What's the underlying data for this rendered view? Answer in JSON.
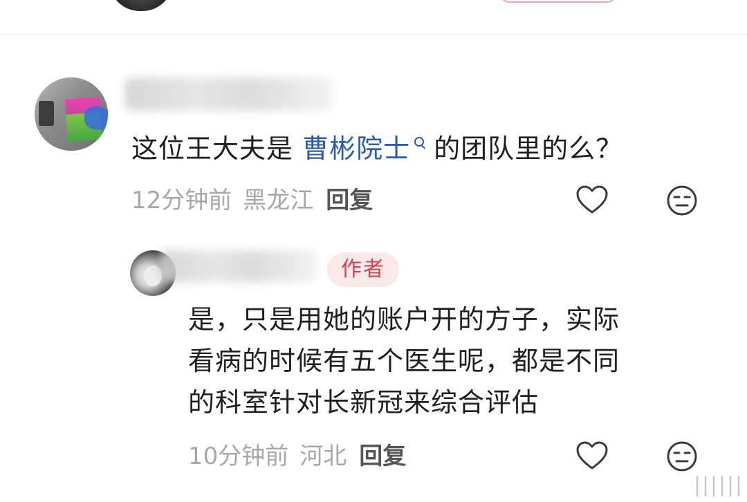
{
  "comment": {
    "text_prefix": "这位王大夫是 ",
    "text_link": "曹彬院士",
    "text_suffix": "的团队里的么？",
    "time": "12分钟前",
    "region": "黑龙江",
    "reply_label": "回复"
  },
  "reply": {
    "author_badge": "作者",
    "lines": [
      "是，只是用她的账户开的方子，实际",
      "看病的时候有五个医生呢，都是不同",
      "的科室针对长新冠来综合评估"
    ],
    "time": "10分钟前",
    "region": "河北",
    "reply_label": "回复"
  },
  "colors": {
    "link": "#2b5aa8",
    "badge_text": "#d24150",
    "badge_bg": "#fbe9ea",
    "meta_gray": "#a7a7a7"
  },
  "icons": {
    "like": "heart-outline-icon",
    "reaction": "neutral-face-icon",
    "topic_search": "search-icon"
  }
}
